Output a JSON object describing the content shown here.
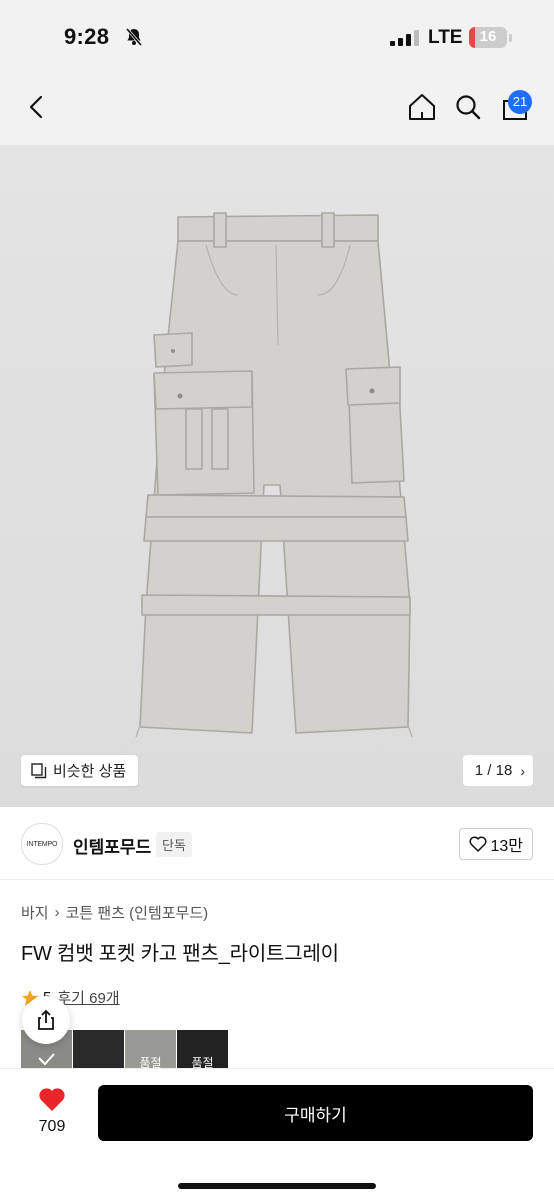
{
  "status": {
    "time": "9:28",
    "network": "LTE",
    "battery": "16",
    "battery_fraction": 0.16
  },
  "nav": {
    "cart_count": "21"
  },
  "hero": {
    "similar_label": "비슷한 상품",
    "pager": "1 / 18"
  },
  "brand": {
    "logo_text": "INTEMPO",
    "name": "인템포무드",
    "badge": "단독",
    "like_count": "13만"
  },
  "product": {
    "breadcrumb": [
      "바지",
      "코튼 팬츠 (인템포무드)"
    ],
    "title": "FW 컴뱃 포켓 카고 팬츠_라이트그레이",
    "rating": "5",
    "reviews": "후기 69개"
  },
  "swatches": [
    {
      "color": "#8a8a86",
      "label": ""
    },
    {
      "color": "#2a2a2a",
      "label": ""
    },
    {
      "color": "#9a9a95",
      "label": "품절"
    },
    {
      "color": "#222222",
      "label": "품절"
    }
  ],
  "bottom": {
    "likes": "709",
    "buy_label": "구매하기"
  },
  "colors": {
    "accent": "#1f6fff",
    "heart": "#e8262c",
    "star": "#f5a623"
  }
}
